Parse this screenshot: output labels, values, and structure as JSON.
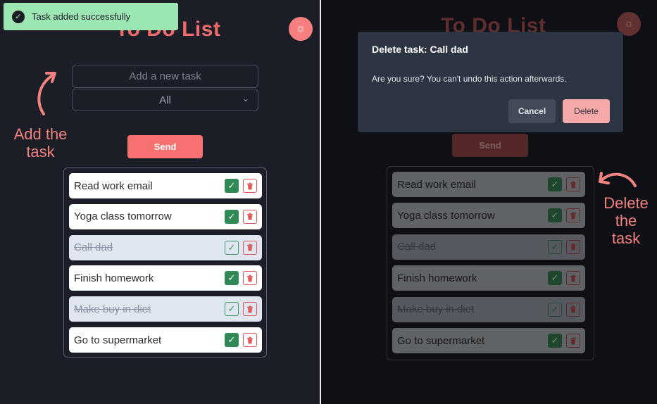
{
  "left": {
    "title": "To Do List",
    "toast": "Task added successfully",
    "input_placeholder": "Add a new task",
    "filter_value": "All",
    "send_label": "Send",
    "annotation_line1": "Add the",
    "annotation_line2": "task",
    "tasks": [
      {
        "text": "Read work email",
        "done": false
      },
      {
        "text": "Yoga class tomorrow",
        "done": false
      },
      {
        "text": "Call dad",
        "done": true
      },
      {
        "text": "Finish homework",
        "done": false
      },
      {
        "text": "Make buy in diet",
        "done": true
      },
      {
        "text": "Go to supermarket",
        "done": false
      }
    ]
  },
  "right": {
    "title": "To Do List",
    "send_label": "Send",
    "annotation_line1": "Delete",
    "annotation_line2": "the",
    "annotation_line3": "task",
    "modal": {
      "title": "Delete task: Call dad",
      "body": "Are you sure? You can't undo this action afterwards.",
      "cancel_label": "Cancel",
      "delete_label": "Delete"
    },
    "tasks": [
      {
        "text": "Read work email",
        "done": false
      },
      {
        "text": "Yoga class tomorrow",
        "done": false
      },
      {
        "text": "Call dad",
        "done": true
      },
      {
        "text": "Finish homework",
        "done": false
      },
      {
        "text": "Make buy in diet",
        "done": true
      },
      {
        "text": "Go to supermarket",
        "done": false
      }
    ]
  },
  "colors": {
    "accent": "#f87171",
    "success": "#9be6b2",
    "check": "#2f8a56"
  },
  "icons": {
    "theme": "sun-icon",
    "complete": "check-icon",
    "delete": "trash-icon",
    "toast": "check-circle-icon",
    "select": "chevron-down-icon"
  }
}
